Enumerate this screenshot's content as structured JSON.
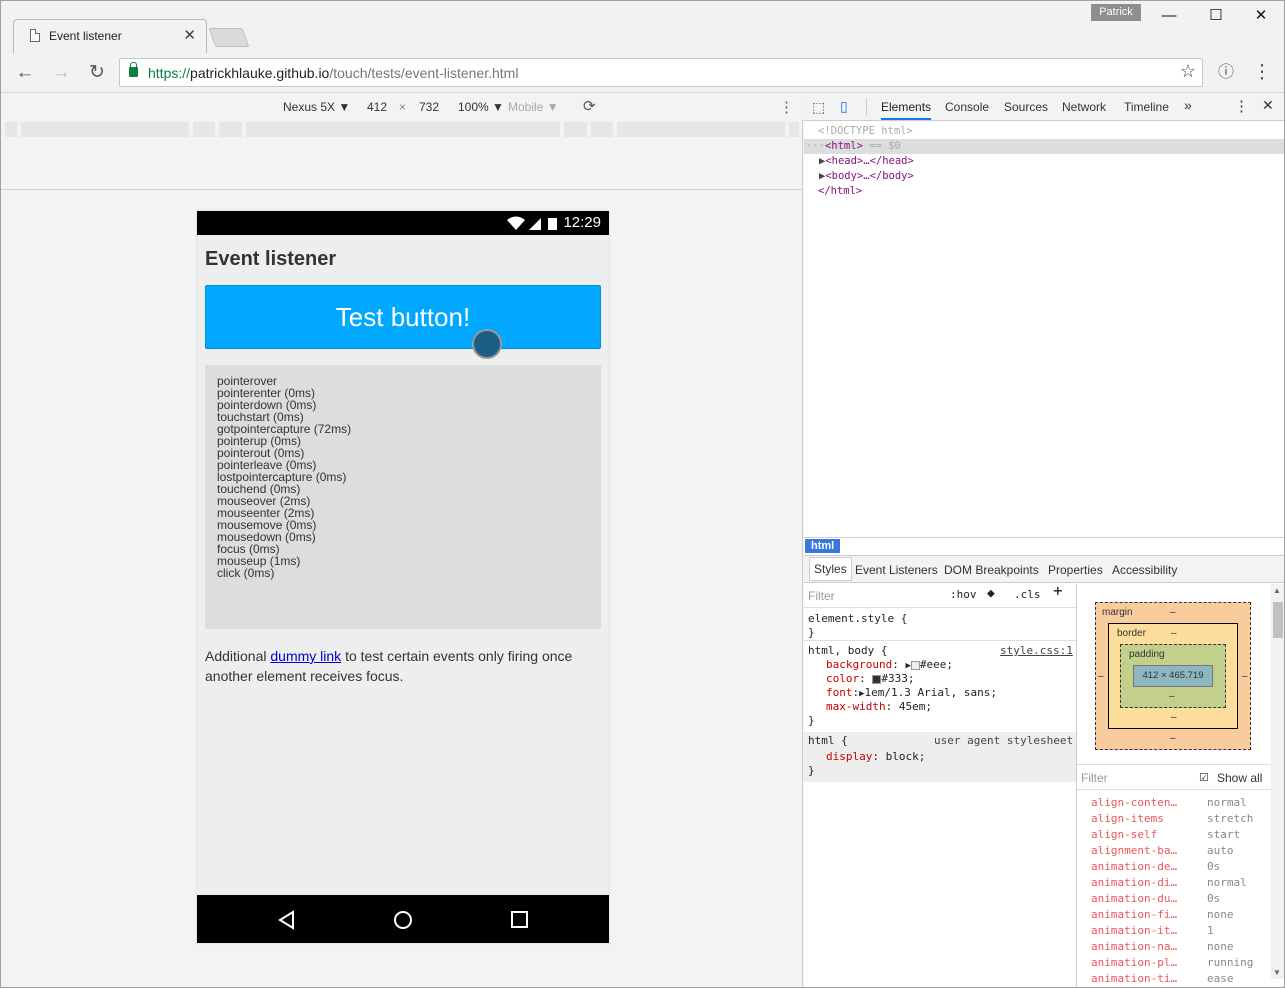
{
  "window": {
    "user": "Patrick"
  },
  "tab": {
    "title": "Event listener"
  },
  "omnibox": {
    "scheme": "https://",
    "host": "patrickhlauke.github.io",
    "path": "/touch/tests/event-listener.html"
  },
  "device_toolbar": {
    "device": "Nexus 5X",
    "width": "412",
    "times": "×",
    "height": "732",
    "zoom": "100%",
    "mode": "Mobile"
  },
  "phone": {
    "time": "12:29",
    "heading": "Event listener",
    "button_label": "Test button!",
    "log": [
      "pointerover",
      "pointerenter (0ms)",
      "pointerdown (0ms)",
      "touchstart (0ms)",
      "gotpointercapture (72ms)",
      "pointerup (0ms)",
      "pointerout (0ms)",
      "pointerleave (0ms)",
      "lostpointercapture (0ms)",
      "touchend (0ms)",
      "mouseover (2ms)",
      "mouseenter (2ms)",
      "mousemove (0ms)",
      "mousedown (0ms)",
      "focus (0ms)",
      "mouseup (1ms)",
      "click (0ms)"
    ],
    "para_before": "Additional ",
    "link": "dummy link",
    "para_after": " to test certain events only firing once another element receives focus."
  },
  "devtools": {
    "tabs": [
      "Elements",
      "Console",
      "Sources",
      "Network",
      "Timeline"
    ],
    "dom": {
      "doctype": "<!DOCTYPE html>",
      "html_open": "<html>",
      "selected_marker": "== $0",
      "head": "<head>…</head>",
      "body": "<body>…</body>",
      "html_close": "</html>"
    },
    "breadcrumb": "html",
    "subtabs": [
      "Styles",
      "Event Listeners",
      "DOM Breakpoints",
      "Properties",
      "Accessibility"
    ],
    "filter_placeholder": "Filter",
    "hov": ":hov",
    "cls": ".cls",
    "rules": {
      "element_style": "element.style {",
      "close": "}",
      "rule1_selector": "html, body {",
      "rule1_source": "style.css:1",
      "rule1_props": [
        {
          "name": "background",
          "value": "#eee;",
          "swatch": "#eeeeee"
        },
        {
          "name": "color",
          "value": "#333;",
          "swatch": "#333333"
        },
        {
          "name": "font",
          "value": "1em/1.3 Arial, sans;"
        },
        {
          "name": "max-width",
          "value": "45em;"
        }
      ],
      "rule2_selector": "html {",
      "rule2_source": "user agent stylesheet",
      "rule2_prop": {
        "name": "display",
        "value": "block;"
      }
    },
    "boxmodel": {
      "margin": "margin",
      "border": "border",
      "padding": "padding",
      "dash": "–",
      "content": "412 × 465.719"
    },
    "computed_filter": "Filter",
    "show_all": "Show all",
    "computed": [
      {
        "name": "align-conten…",
        "value": "normal"
      },
      {
        "name": "align-items",
        "value": "stretch"
      },
      {
        "name": "align-self",
        "value": "start"
      },
      {
        "name": "alignment-ba…",
        "value": "auto"
      },
      {
        "name": "animation-de…",
        "value": "0s"
      },
      {
        "name": "animation-di…",
        "value": "normal"
      },
      {
        "name": "animation-du…",
        "value": "0s"
      },
      {
        "name": "animation-fi…",
        "value": "none"
      },
      {
        "name": "animation-it…",
        "value": "1"
      },
      {
        "name": "animation-na…",
        "value": "none"
      },
      {
        "name": "animation-pl…",
        "value": "running"
      },
      {
        "name": "animation-ti…",
        "value": "ease"
      }
    ]
  }
}
